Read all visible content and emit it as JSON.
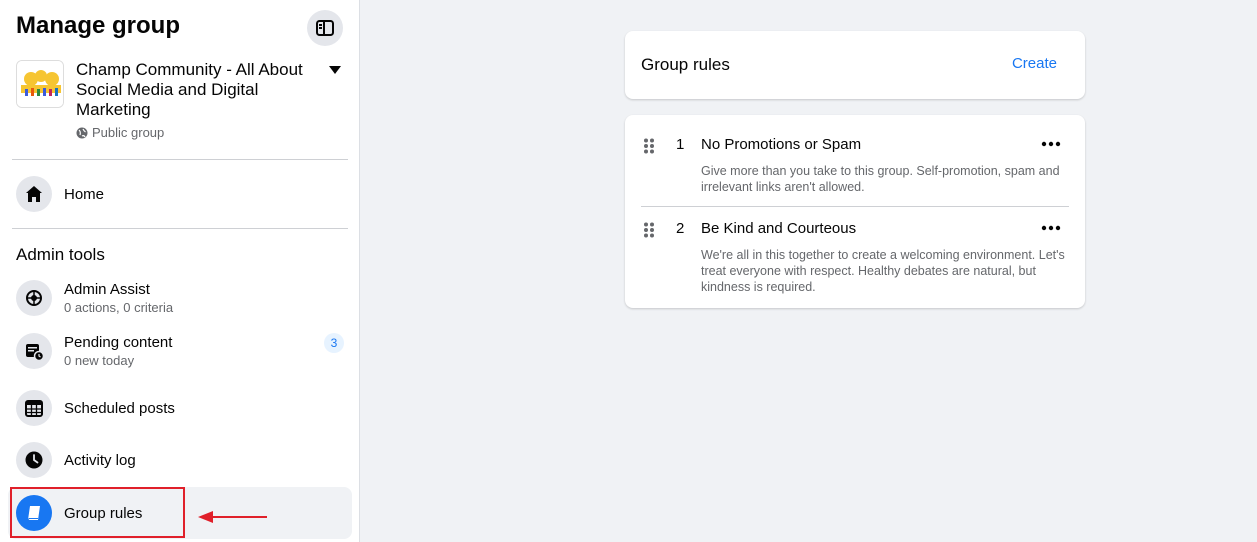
{
  "sidebar": {
    "title": "Manage group",
    "group": {
      "name": "Champ Community - All About Social Media and Digital Marketing",
      "type": "Public group"
    },
    "home_label": "Home",
    "admin_tools_title": "Admin tools",
    "items": [
      {
        "label": "Admin Assist",
        "sub": "0 actions, 0 criteria"
      },
      {
        "label": "Pending content",
        "sub": "0 new today",
        "badge": "3"
      },
      {
        "label": "Scheduled posts"
      },
      {
        "label": "Activity log"
      },
      {
        "label": "Group rules"
      }
    ]
  },
  "main": {
    "header_title": "Group rules",
    "create_label": "Create",
    "rules": [
      {
        "num": "1",
        "title": "No Promotions or Spam",
        "desc": "Give more than you take to this group. Self-promotion, spam and irrelevant links aren't allowed."
      },
      {
        "num": "2",
        "title": "Be Kind and Courteous",
        "desc": "We're all in this together to create a welcoming environment. Let's treat everyone with respect. Healthy debates are natural, but kindness is required."
      }
    ]
  },
  "colors": {
    "accent": "#1877f2",
    "highlight": "#e0202a"
  }
}
